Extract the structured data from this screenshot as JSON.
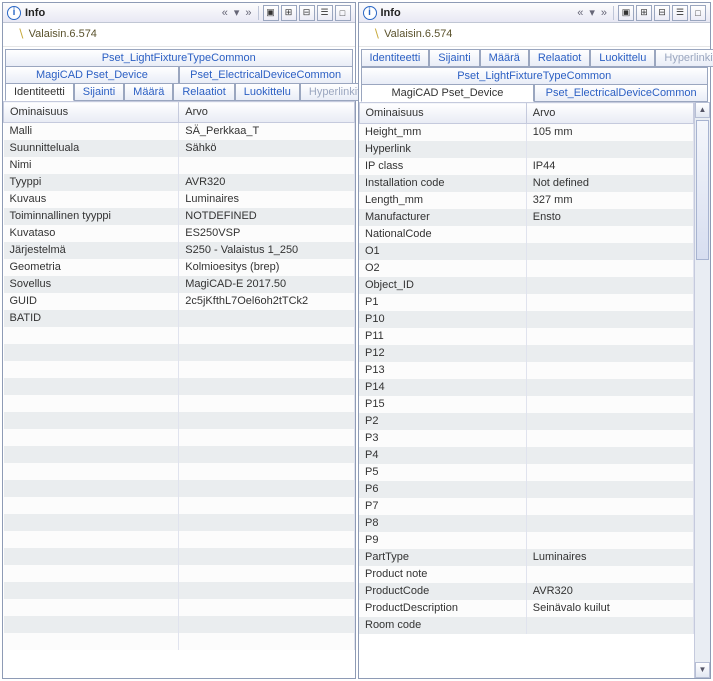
{
  "header": {
    "title": "Info",
    "object_label": "Valaisin.6.574"
  },
  "tabs": {
    "main": [
      {
        "id": "identiteetti",
        "label": "Identiteetti"
      },
      {
        "id": "sijainti",
        "label": "Sijainti"
      },
      {
        "id": "maara",
        "label": "Määrä"
      },
      {
        "id": "relaatiot",
        "label": "Relaatiot"
      },
      {
        "id": "luokittelu",
        "label": "Luokittelu"
      },
      {
        "id": "hyperlinkit",
        "label": "Hyperlinkit"
      }
    ],
    "pset_common": {
      "label": "Pset_LightFixtureTypeCommon"
    },
    "pset_row2": [
      {
        "id": "magicad",
        "label": "MagiCAD Pset_Device"
      },
      {
        "id": "elec",
        "label": "Pset_ElectricalDeviceCommon"
      }
    ]
  },
  "columns": {
    "prop": "Ominaisuus",
    "val": "Arvo"
  },
  "left_rows": [
    {
      "p": "Malli",
      "v": "SÄ_Perkkaa_T"
    },
    {
      "p": "Suunnitteluala",
      "v": "Sähkö"
    },
    {
      "p": "Nimi",
      "v": ""
    },
    {
      "p": "Tyyppi",
      "v": "AVR320"
    },
    {
      "p": "Kuvaus",
      "v": "Luminaires"
    },
    {
      "p": "Toiminnallinen tyyppi",
      "v": "NOTDEFINED"
    },
    {
      "p": "Kuvataso",
      "v": "ES250VSP"
    },
    {
      "p": "Järjestelmä",
      "v": "S250 - Valaistus 1_250"
    },
    {
      "p": "Geometria",
      "v": "Kolmioesitys (brep)"
    },
    {
      "p": "Sovellus",
      "v": "MagiCAD-E 2017.50"
    },
    {
      "p": "GUID",
      "v": "2c5jKfthL7Oel6oh2tTCk2"
    },
    {
      "p": "BATID",
      "v": ""
    }
  ],
  "right_rows": [
    {
      "p": "Height_mm",
      "v": "105 mm"
    },
    {
      "p": "Hyperlink",
      "v": ""
    },
    {
      "p": "IP class",
      "v": "IP44"
    },
    {
      "p": "Installation code",
      "v": "Not defined"
    },
    {
      "p": "Length_mm",
      "v": "327 mm"
    },
    {
      "p": "Manufacturer",
      "v": "Ensto"
    },
    {
      "p": "NationalCode",
      "v": ""
    },
    {
      "p": "O1",
      "v": ""
    },
    {
      "p": "O2",
      "v": ""
    },
    {
      "p": "Object_ID",
      "v": ""
    },
    {
      "p": "P1",
      "v": ""
    },
    {
      "p": "P10",
      "v": ""
    },
    {
      "p": "P11",
      "v": ""
    },
    {
      "p": "P12",
      "v": ""
    },
    {
      "p": "P13",
      "v": ""
    },
    {
      "p": "P14",
      "v": ""
    },
    {
      "p": "P15",
      "v": ""
    },
    {
      "p": "P2",
      "v": ""
    },
    {
      "p": "P3",
      "v": ""
    },
    {
      "p": "P4",
      "v": ""
    },
    {
      "p": "P5",
      "v": ""
    },
    {
      "p": "P6",
      "v": ""
    },
    {
      "p": "P7",
      "v": ""
    },
    {
      "p": "P8",
      "v": ""
    },
    {
      "p": "P9",
      "v": ""
    },
    {
      "p": "PartType",
      "v": "Luminaires"
    },
    {
      "p": "Product note",
      "v": ""
    },
    {
      "p": "ProductCode",
      "v": "AVR320"
    },
    {
      "p": "ProductDescription",
      "v": "Seinävalo kuilut"
    },
    {
      "p": "Room code",
      "v": ""
    }
  ],
  "left_pad_rows": 19
}
